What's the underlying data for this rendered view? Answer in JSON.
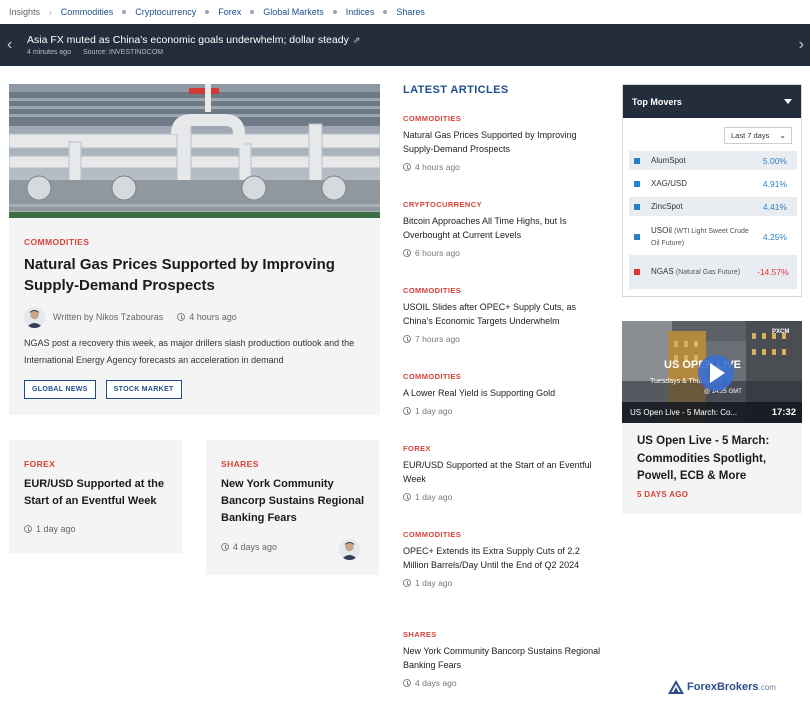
{
  "breadcrumb": {
    "first": "Insights",
    "items": [
      "Commodities",
      "Cryptocurrency",
      "Forex",
      "Global Markets",
      "Indices",
      "Shares"
    ]
  },
  "ticker": {
    "headline": "Asia FX muted as China's economic goals underwhelm; dollar steady",
    "time": "4 minutes ago",
    "source": "Source: INVESTINGCOM"
  },
  "featured": {
    "category": "COMMODITIES",
    "title": "Natural Gas Prices Supported by Improving Supply-Demand Prospects",
    "author": "Written by Nikos Tzabouras",
    "time": "4 hours ago",
    "summary": "NGAS post a recovery this week, as major drillers slash production outlook and the International Energy Agency forecasts an acceleration in demand",
    "tags": [
      "GLOBAL NEWS",
      "STOCK MARKET"
    ]
  },
  "cards": [
    {
      "category": "FOREX",
      "title": "EUR/USD Supported at the Start of an Eventful Week",
      "time": "1 day ago"
    },
    {
      "category": "SHARES",
      "title": "New York Community Bancorp Sustains Regional Banking Fears",
      "time": "4 days ago"
    }
  ],
  "latest": {
    "header": "LATEST ARTICLES",
    "articles": [
      {
        "category": "COMMODITIES",
        "title": "Natural Gas Prices Supported by Improving Supply-Demand Prospects",
        "time": "4 hours ago"
      },
      {
        "category": "CRYPTOCURRENCY",
        "title": "Bitcoin Approaches All Time Highs, but Is Overbought at Current Levels",
        "time": "6 hours ago"
      },
      {
        "category": "COMMODITIES",
        "title": "USOIL Slides after OPEC+ Supply Cuts, as China's Economic Targets Underwhelm",
        "time": "7 hours ago"
      },
      {
        "category": "COMMODITIES",
        "title": "A Lower Real Yield is Supporting Gold",
        "time": "1 day ago"
      },
      {
        "category": "FOREX",
        "title": "EUR/USD Supported at the Start of an Eventful Week",
        "time": "1 day ago"
      },
      {
        "category": "COMMODITIES",
        "title": "OPEC+ Extends its Extra Supply Cuts of 2.2 Million Barrels/Day Until the End of Q2 2024",
        "time": "1 day ago"
      },
      {
        "category": "SHARES",
        "title": "New York Community Bancorp Sustains Regional Banking Fears",
        "time": "4 days ago"
      }
    ]
  },
  "movers": {
    "header": "Top Movers",
    "period": "Last 7 days",
    "rows": [
      {
        "name": "AlumSpot",
        "sub": "",
        "pct": "5.00%",
        "dir": "up"
      },
      {
        "name": "XAG/USD",
        "sub": "",
        "pct": "4.91%",
        "dir": "up"
      },
      {
        "name": "ZincSpot",
        "sub": "",
        "pct": "4.41%",
        "dir": "up"
      },
      {
        "name": "USOil",
        "sub": "(WTI Light Sweet Crude Oil Future)",
        "pct": "4.25%",
        "dir": "up"
      },
      {
        "name": "NGAS",
        "sub": "(Natural Gas Future)",
        "pct": "-14.57%",
        "dir": "down"
      }
    ]
  },
  "video": {
    "overlay_title": "US OPEN LIVE",
    "overlay_sub": "Tuesdays & Thursdays",
    "overlay_time": "@ 14:25 GMT",
    "brand": "PXCM",
    "caption": "US Open Live - 5 March: Co...",
    "duration": "17:32",
    "title": "US Open Live - 5 March: Commodities Spotlight, Powell, ECB & More",
    "when": "5 DAYS AGO"
  },
  "watermark": {
    "a": "ForexBrokers",
    "b": ".com"
  },
  "colors": {
    "accent": "#1f4e8c",
    "category": "#d9413a",
    "up": "#2b7fc4",
    "down": "#e0353c",
    "dark": "#242d3c"
  }
}
